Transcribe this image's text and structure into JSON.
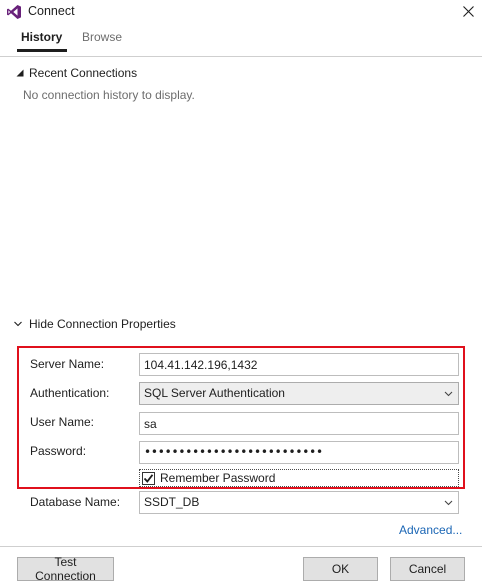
{
  "window": {
    "title": "Connect",
    "icon": "visual-studio-logo-icon",
    "close_icon": "close-icon"
  },
  "tabs": [
    {
      "label": "History",
      "selected": true
    },
    {
      "label": "Browse",
      "selected": false
    }
  ],
  "recent": {
    "header": "Recent Connections",
    "empty_message": "No connection history to display."
  },
  "properties": {
    "toggle_label": "Hide Connection Properties",
    "server_name_label": "Server Name:",
    "server_name_value": "104.41.142.196,1432",
    "authentication_label": "Authentication:",
    "authentication_value": "SQL Server Authentication",
    "user_name_label": "User Name:",
    "user_name_value": "sa",
    "password_label": "Password:",
    "password_value": "••••••••••••••••••••••••••",
    "remember_password_label": "Remember Password",
    "remember_password_checked": true,
    "database_name_label": "Database Name:",
    "database_name_value": "SSDT_DB",
    "advanced_link": "Advanced..."
  },
  "buttons": {
    "test_connection": "Test Connection",
    "ok": "OK",
    "cancel": "Cancel"
  },
  "colors": {
    "highlight_border": "#e0101c",
    "link": "#1b66b5",
    "vs_purple": "#68217a"
  }
}
